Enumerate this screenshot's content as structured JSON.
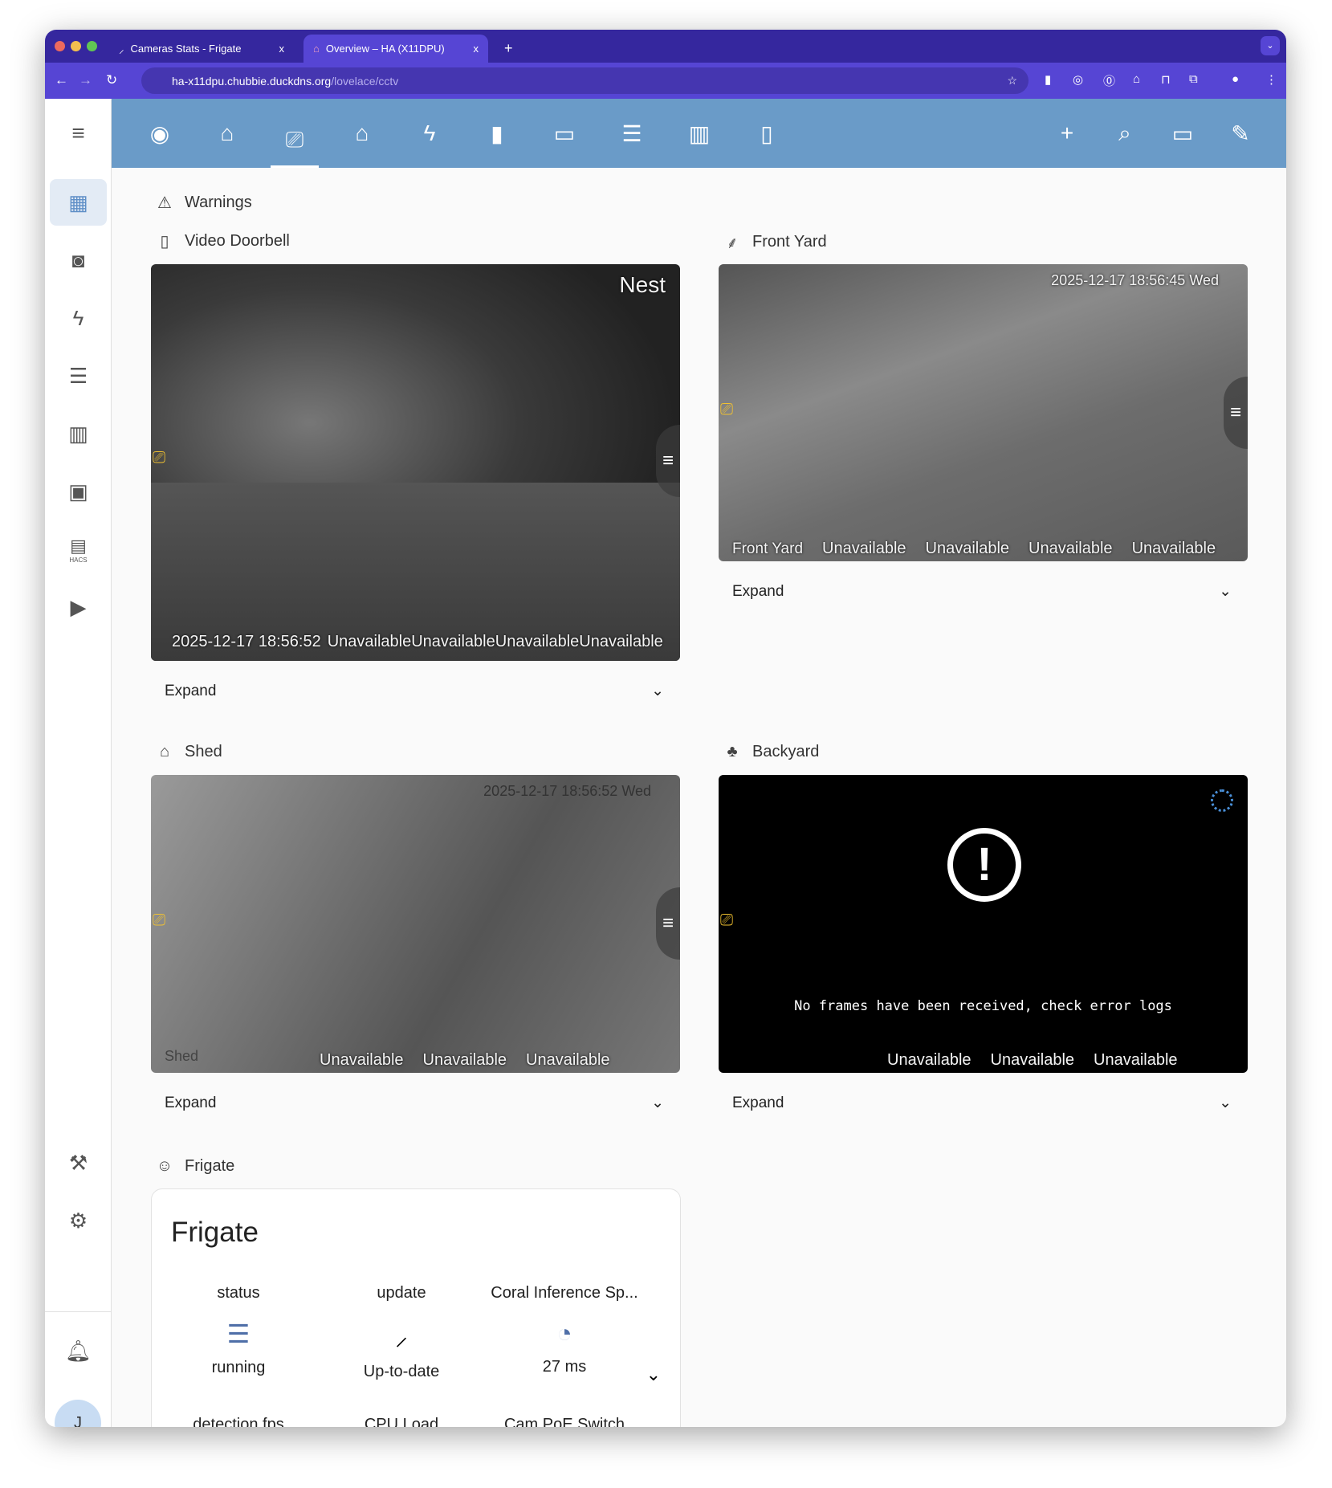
{
  "browser": {
    "tabs": [
      {
        "title": "Cameras Stats - Frigate",
        "close": "x"
      },
      {
        "title": "Overview – HA (X11DPU)",
        "close": "x"
      }
    ],
    "new_tab": "+",
    "url_host": "ha-x11dpu.chubbie.duckdns.org",
    "url_path": "/lovelace/cctv"
  },
  "sidebar": {
    "items": [
      "overview",
      "map",
      "energy",
      "logbook",
      "history",
      "calendar",
      "hacs",
      "media"
    ],
    "hacs_label": "HACS",
    "avatar": "J"
  },
  "header": {
    "views": [
      "eye",
      "home",
      "cctv",
      "home-thermometer",
      "lightning",
      "battery",
      "hvac",
      "server",
      "network",
      "phone"
    ]
  },
  "sections": {
    "warnings": "Warnings",
    "doorbell": {
      "title": "Video Doorbell",
      "brand": "Nest",
      "timestamp": "2025-12-17 18:56:52",
      "states": [
        "Unavailable",
        "Unavailable",
        "Unavailable",
        "Unavailable"
      ],
      "expand": "Expand"
    },
    "front_yard": {
      "title": "Front Yard",
      "timestamp": "2025-12-17 18:56:45 Wed",
      "label": "Front Yard",
      "states": [
        "Unavailable",
        "Unavailable",
        "Unavailable",
        "Unavailable"
      ],
      "expand": "Expand"
    },
    "shed": {
      "title": "Shed",
      "timestamp": "2025-12-17 18:56:52 Wed",
      "label": "Shed",
      "states": [
        "Unavailable",
        "Unavailable",
        "Unavailable"
      ],
      "expand": "Expand"
    },
    "backyard": {
      "title": "Backyard",
      "error": "No frames have been received, check error logs",
      "states": [
        "Unavailable",
        "Unavailable",
        "Unavailable"
      ],
      "expand": "Expand"
    },
    "frigate": {
      "title": "Frigate",
      "card_title": "Frigate",
      "entities": [
        {
          "name": "status",
          "state": "running"
        },
        {
          "name": "update",
          "state": "Up-to-date"
        },
        {
          "name": "Coral Inference Sp...",
          "state": "27 ms"
        }
      ],
      "next_row": [
        "detection fps",
        "CPU Load",
        "Cam PoE Switch"
      ]
    }
  }
}
